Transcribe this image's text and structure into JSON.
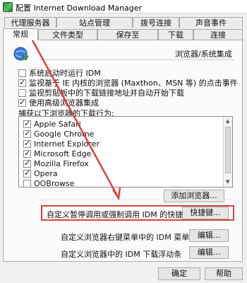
{
  "window": {
    "title": "配置 Internet Download Manager"
  },
  "tabs_row1": [
    "代理服务器",
    "站点管理",
    "拨号连接",
    "声音事件"
  ],
  "tabs_row2": [
    "常规",
    "文件类型",
    "保存至",
    "下载",
    "连接"
  ],
  "section": {
    "title": "浏览器/系统集成"
  },
  "options": [
    {
      "label": "系统启动时运行 IDM",
      "checked": false
    },
    {
      "label": "监视基于 IE 内核的浏览器 (Maxthon、MSN 等) 的点击事件",
      "checked": true
    },
    {
      "label": "监视剪贴板中的下载链接地址并自动开始下载",
      "checked": false
    },
    {
      "label": "使用高级浏览器集成",
      "checked": true
    }
  ],
  "browsers": {
    "group_label": "捕获以下浏览器的下载行为:",
    "items": [
      {
        "name": "Apple Safari",
        "checked": true
      },
      {
        "name": "Google Chrome",
        "checked": true
      },
      {
        "name": "Internet Explorer",
        "checked": true
      },
      {
        "name": "Microsoft Edge",
        "checked": true
      },
      {
        "name": "Mozilla Firefox",
        "checked": true
      },
      {
        "name": "Opera",
        "checked": true
      },
      {
        "name": "OOBrowse",
        "checked": false
      }
    ],
    "add_button": "添加浏览器..."
  },
  "hotkey": {
    "label": "自定义暂停调用或强制调用 IDM 的快捷键",
    "button": "快捷键..."
  },
  "context_menu": {
    "label": "自定义浏览器右键菜单中的 IDM 菜单项",
    "button": "编辑..."
  },
  "download_panel": {
    "label": "自定义浏览器中的 IDM 下载浮动条",
    "button": "编辑..."
  },
  "footer": {
    "ok": "确定",
    "help": "帮助"
  },
  "colors": {
    "annotation": "#e04040",
    "panel": "#fbfbfb",
    "window_bg": "#f0f0f0"
  }
}
